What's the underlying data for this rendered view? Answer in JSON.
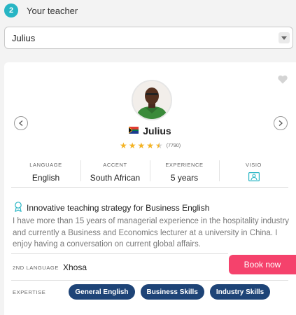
{
  "step": {
    "number": "2",
    "title": "Your teacher"
  },
  "teacher_select": {
    "value": "Julius"
  },
  "teacher": {
    "name": "Julius",
    "flag": "south-africa-flag",
    "rating": 4.5,
    "reviews": "(7790)"
  },
  "stats": {
    "language_label": "LANGUAGE",
    "language_value": "English",
    "accent_label": "ACCENT",
    "accent_value": "South African",
    "experience_label": "EXPERIENCE",
    "experience_value": "5 years",
    "visio_label": "VISIO"
  },
  "strategy": "Innovative teaching strategy for Business English",
  "description": "I have more than 15 years of managerial experience in the hospitality industry and currently a Business and Economics lecturer at a university in China. I enjoy having a conversation on current global affairs.",
  "second_language": {
    "label": "2ND LANGUAGE",
    "value": "Xhosa"
  },
  "book_button": "Book now",
  "expertise": {
    "label": "EXPERTISE",
    "items": [
      "General English",
      "Business Skills",
      "Industry Skills"
    ]
  },
  "colors": {
    "step_accent": "#27b5c4",
    "book_button": "#f5426c",
    "chip": "#1e4477",
    "star": "#f4b324"
  },
  "icons": [
    "chevron-down-icon",
    "heart-icon",
    "chevron-left-icon",
    "chevron-right-icon",
    "video-icon",
    "award-icon"
  ]
}
